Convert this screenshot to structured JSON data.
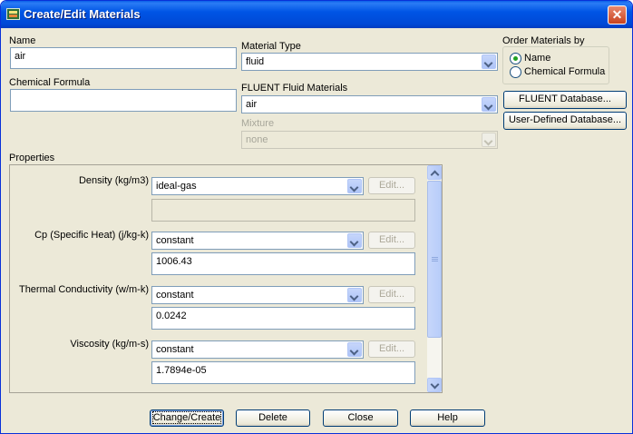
{
  "window": {
    "title": "Create/Edit Materials"
  },
  "name": {
    "label": "Name",
    "value": "air"
  },
  "chemical_formula": {
    "label": "Chemical Formula",
    "value": ""
  },
  "material_type": {
    "label": "Material Type",
    "value": "fluid"
  },
  "fluent_fluid_materials": {
    "label": "FLUENT Fluid Materials",
    "value": "air"
  },
  "mixture": {
    "label": "Mixture",
    "value": "none"
  },
  "order_by": {
    "label": "Order Materials by",
    "options": [
      {
        "label": "Name",
        "checked": true
      },
      {
        "label": "Chemical Formula",
        "checked": false
      }
    ]
  },
  "side_buttons": {
    "fluent_db": "FLUENT Database...",
    "user_db": "User-Defined Database..."
  },
  "properties": {
    "label": "Properties",
    "edit_label": "Edit...",
    "items": [
      {
        "label": "Density (kg/m3)",
        "method": "ideal-gas",
        "value": ""
      },
      {
        "label": "Cp (Specific Heat) (j/kg-k)",
        "method": "constant",
        "value": "1006.43"
      },
      {
        "label": "Thermal Conductivity (w/m-k)",
        "method": "constant",
        "value": "0.0242"
      },
      {
        "label": "Viscosity (kg/m-s)",
        "method": "constant",
        "value": "1.7894e-05"
      }
    ]
  },
  "footer": {
    "change_create": "Change/Create",
    "delete": "Delete",
    "close": "Close",
    "help": "Help"
  }
}
